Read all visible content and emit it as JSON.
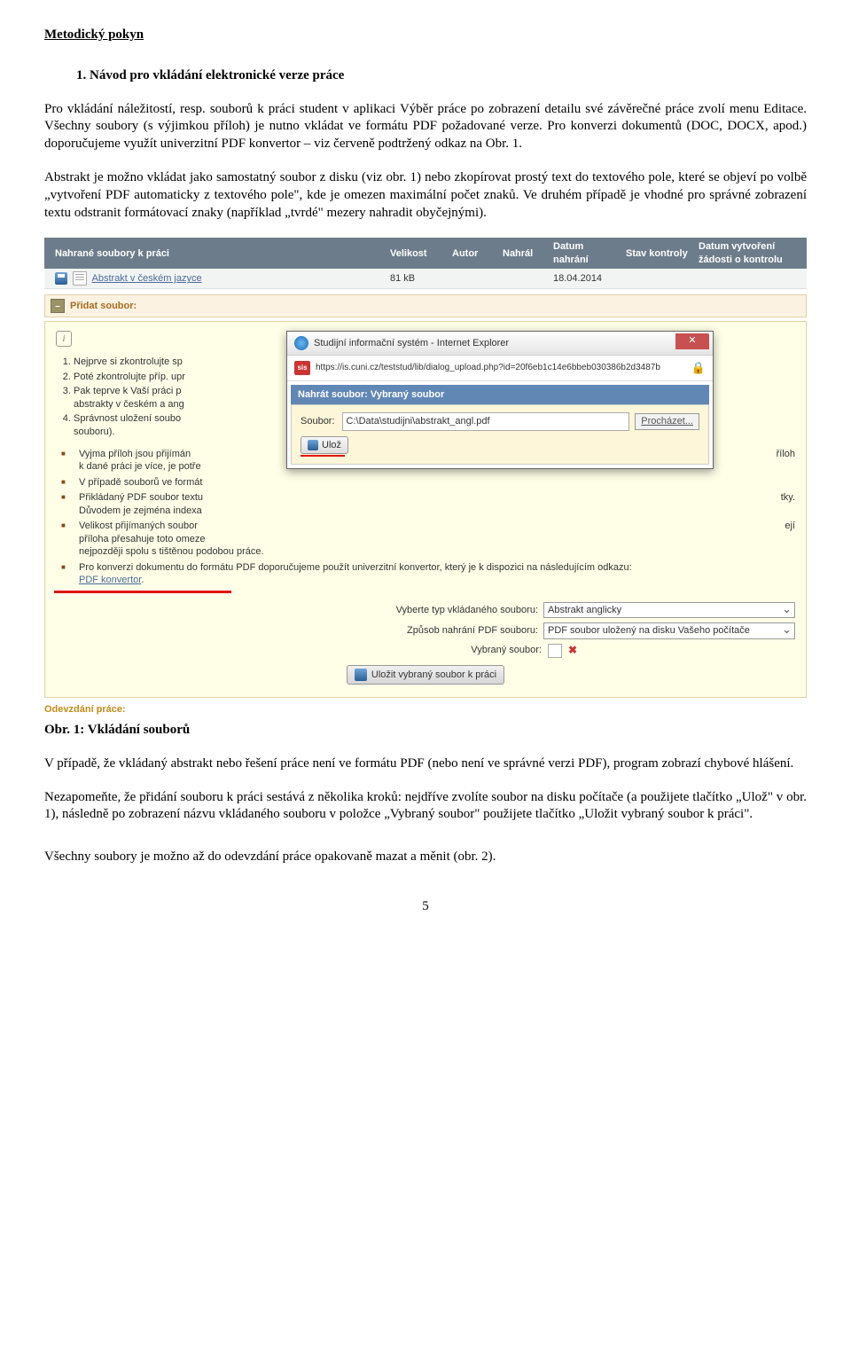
{
  "doc": {
    "section": "Metodický pokyn",
    "subsection": "1.   Návod pro vkládání elektronické verze práce",
    "p1": "Pro vkládání náležitostí, resp. souborů k práci student v aplikaci Výběr práce po zobrazení detailu své závěrečné práce zvolí menu Editace. Všechny soubory (s výjimkou příloh) je nutno vkládat ve formátu PDF požadované verze. Pro konverzi dokumentů (DOC, DOCX, apod.) doporučujeme využít univerzitní PDF konvertor – viz červeně podtržený odkaz na Obr. 1.",
    "p2": "Abstrakt je možno vkládat jako samostatný soubor z disku (viz obr. 1) nebo zkopírovat prostý text do textového pole, které se objeví po volbě „vytvoření PDF automaticky z textového pole\", kde je omezen maximální počet znaků. Ve druhém případě je vhodné pro správné zobrazení textu odstranit formátovací znaky (například „tvrdé\" mezery nahradit obyčejnými).",
    "fig_caption": "Obr. 1: Vkládání souborů",
    "p3": "V případě, že vkládaný abstrakt nebo řešení práce není ve formátu PDF (nebo není ve správné verzi PDF), program zobrazí chybové hlášení.",
    "p4": "Nezapomeňte, že přidání souboru k práci sestává z několika kroků: nejdříve zvolíte soubor na disku počítače (a použijete tlačítko „Ulož\" v obr. 1), následně po zobrazení názvu vkládaného souboru v položce „Vybraný soubor\" použijete tlačítko „Uložit vybraný soubor k práci\".",
    "p5": "Všechny soubory je možno až do odevzdání práce opakovaně mazat a měnit (obr. 2).",
    "page_number": "5"
  },
  "shot": {
    "table_header": {
      "title": "Nahrané soubory k práci",
      "size": "Velikost",
      "author": "Autor",
      "uploaded_by": "Nahrál",
      "date_upload": "Datum nahrání",
      "check_state": "Stav kontroly",
      "request_date": "Datum vytvoření žádosti o kontrolu"
    },
    "row": {
      "name": "Abstrakt v českém jazyce",
      "size": "81 kB",
      "date": "18.04.2014"
    },
    "addfile": "Přidat soubor:",
    "help_items": [
      "Nejprve si zkontrolujte sp",
      "Poté zkontrolujte příp. upr",
      "Pak teprve k Vaší práci p",
      "abstrakty v českém a ang",
      "Správnost uložení soubo",
      "souboru)."
    ],
    "bullets": [
      "Vyjma příloh jsou přijímán",
      "k dané práci je více, je potře",
      "V případě souborů ve formát",
      "Přikládaný PDF soubor textu",
      "Důvodem je zejména indexa",
      "Velikost přijímaných soubor",
      "příloha přesahuje toto omeze",
      "nejpozději spolu s tištěnou podobou práce.",
      "Pro konverzi dokumentu do formátu PDF doporučujeme použít univerzitní konvertor, který je k dispozici na následujícím odkazu:"
    ],
    "bullet_tail_loh": "říloh",
    "bullet_tail_tky": "tky.",
    "bullet_tail_eji": "ejí",
    "pdf_link": "PDF konvertor",
    "form": {
      "type_label": "Vyberte typ vkládaného souboru:",
      "type_value": "Abstrakt anglicky",
      "method_label": "Způsob nahrání PDF souboru:",
      "method_value": "PDF soubor uložený na disku Vašeho počítače",
      "selected_label": "Vybraný soubor:",
      "upload_btn": "Uložit vybraný soubor k práci"
    },
    "footer": "Odevzdání práce:"
  },
  "modal": {
    "title": "Studijní informační systém - Internet Explorer",
    "url": "https://is.cuni.cz/teststud/lib/dialog_upload.php?id=20f6eb1c14e6bbeb030386b2d3487b",
    "bluebar": "Nahrát soubor: Vybraný soubor",
    "file_label": "Soubor:",
    "file_value": "C:\\Data\\studijni\\abstrakt_angl.pdf",
    "browse": "Procházet...",
    "save": "Ulož"
  }
}
